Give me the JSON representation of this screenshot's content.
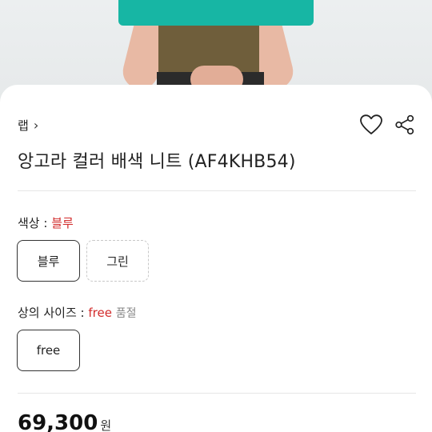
{
  "breadcrumb": {
    "label": "랩",
    "chevron": "›"
  },
  "product": {
    "title": "앙고라 컬러 배색 니트 (AF4KHB54)"
  },
  "color_option": {
    "label": "색상 : ",
    "selected": "블루",
    "choices": [
      "블루",
      "그린"
    ]
  },
  "size_option": {
    "label": "상의 사이즈 : ",
    "selected": "free",
    "status": "품절",
    "choices": [
      "free"
    ]
  },
  "price": {
    "amount": "69,300",
    "currency": "원"
  },
  "icons": {
    "wishlist": "heart-icon",
    "share": "share-icon"
  },
  "colors": {
    "accent_selected": "#d22b2b",
    "sweater_teal": "#17b6a4",
    "sweater_olive": "#6f5e3b"
  }
}
